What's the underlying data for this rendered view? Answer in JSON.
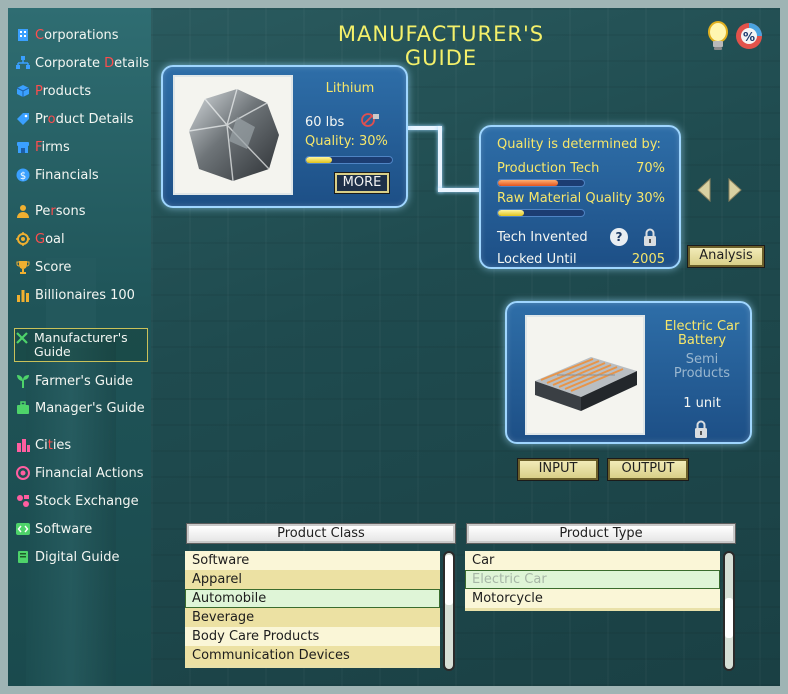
{
  "title": "MANUFACTURER'S GUIDE",
  "sidebar": {
    "items": [
      {
        "pre": "",
        "hl": "C",
        "post": "orporations",
        "icon": "building-icon"
      },
      {
        "pre": "Corporate ",
        "hl": "D",
        "post": "etails",
        "icon": "org-chart-icon"
      },
      {
        "pre": "",
        "hl": "P",
        "post": "roducts",
        "icon": "cube-icon"
      },
      {
        "pre": "Pr",
        "hl": "o",
        "post": "duct Details",
        "icon": "tag-icon"
      },
      {
        "pre": "",
        "hl": "F",
        "post": "irms",
        "icon": "shop-icon"
      },
      {
        "pre": "Financials",
        "hl": "",
        "post": "",
        "icon": "dollar-icon"
      },
      {
        "pre": "Pe",
        "hl": "r",
        "post": "sons",
        "icon": "person-icon"
      },
      {
        "pre": "",
        "hl": "G",
        "post": "oal",
        "icon": "target-icon"
      },
      {
        "pre": "Score",
        "hl": "",
        "post": "",
        "icon": "trophy-icon"
      },
      {
        "pre": "Billionaires 100",
        "hl": "",
        "post": "",
        "icon": "bar-chart-icon"
      },
      {
        "pre": "Manufacturer's Guide",
        "hl": "",
        "post": "",
        "icon": "tools-icon"
      },
      {
        "pre": "Farmer's Guide",
        "hl": "",
        "post": "",
        "icon": "plant-icon"
      },
      {
        "pre": "Manager's Guide",
        "hl": "",
        "post": "",
        "icon": "briefcase-icon"
      },
      {
        "pre": "Ci",
        "hl": "t",
        "post": "ies",
        "icon": "city-icon"
      },
      {
        "pre": "Financial Actions",
        "hl": "",
        "post": "",
        "icon": "coin-icon"
      },
      {
        "pre": "Stock Exchange",
        "hl": "",
        "post": "",
        "icon": "stock-icon"
      },
      {
        "pre": "Software",
        "hl": "",
        "post": "",
        "icon": "code-icon"
      },
      {
        "pre": "Digital Guide",
        "hl": "",
        "post": "",
        "icon": "book-icon"
      }
    ]
  },
  "material": {
    "name": "Lithium",
    "weight": "60 lbs",
    "quality_label": "Quality:",
    "quality_value": "30%",
    "quality_fraction": 0.3,
    "more_label": "MORE"
  },
  "quality_panel": {
    "title": "Quality is determined by:",
    "production_tech_label": "Production Tech",
    "production_tech_value": "70%",
    "production_tech_fraction": 0.7,
    "raw_material_label": "Raw Material Quality",
    "raw_material_value": "30%",
    "raw_material_fraction": 0.3,
    "tech_invented_label": "Tech Invented",
    "help_symbol": "?",
    "locked_until_label": "Locked Until",
    "locked_until_value": "2005"
  },
  "analysis_label": "Analysis",
  "product": {
    "name": "Electric Car Battery",
    "category": "Semi Products",
    "quantity": "1 unit"
  },
  "input_label": "INPUT",
  "output_label": "OUTPUT",
  "product_class": {
    "header": "Product Class",
    "items": [
      "Software",
      "Apparel",
      "Automobile",
      "Beverage",
      "Body Care Products",
      "Communication Devices"
    ],
    "selected": "Automobile"
  },
  "product_type": {
    "header": "Product Type",
    "items": [
      "Car",
      "Electric Car",
      "Motorcycle"
    ],
    "selected": "Electric Car"
  },
  "colors": {
    "title": "#f4f06a",
    "accent_yellow": "#f6e66a",
    "panel_blue": "#2e6ea8",
    "highlight_red": "#ff4d4d"
  }
}
